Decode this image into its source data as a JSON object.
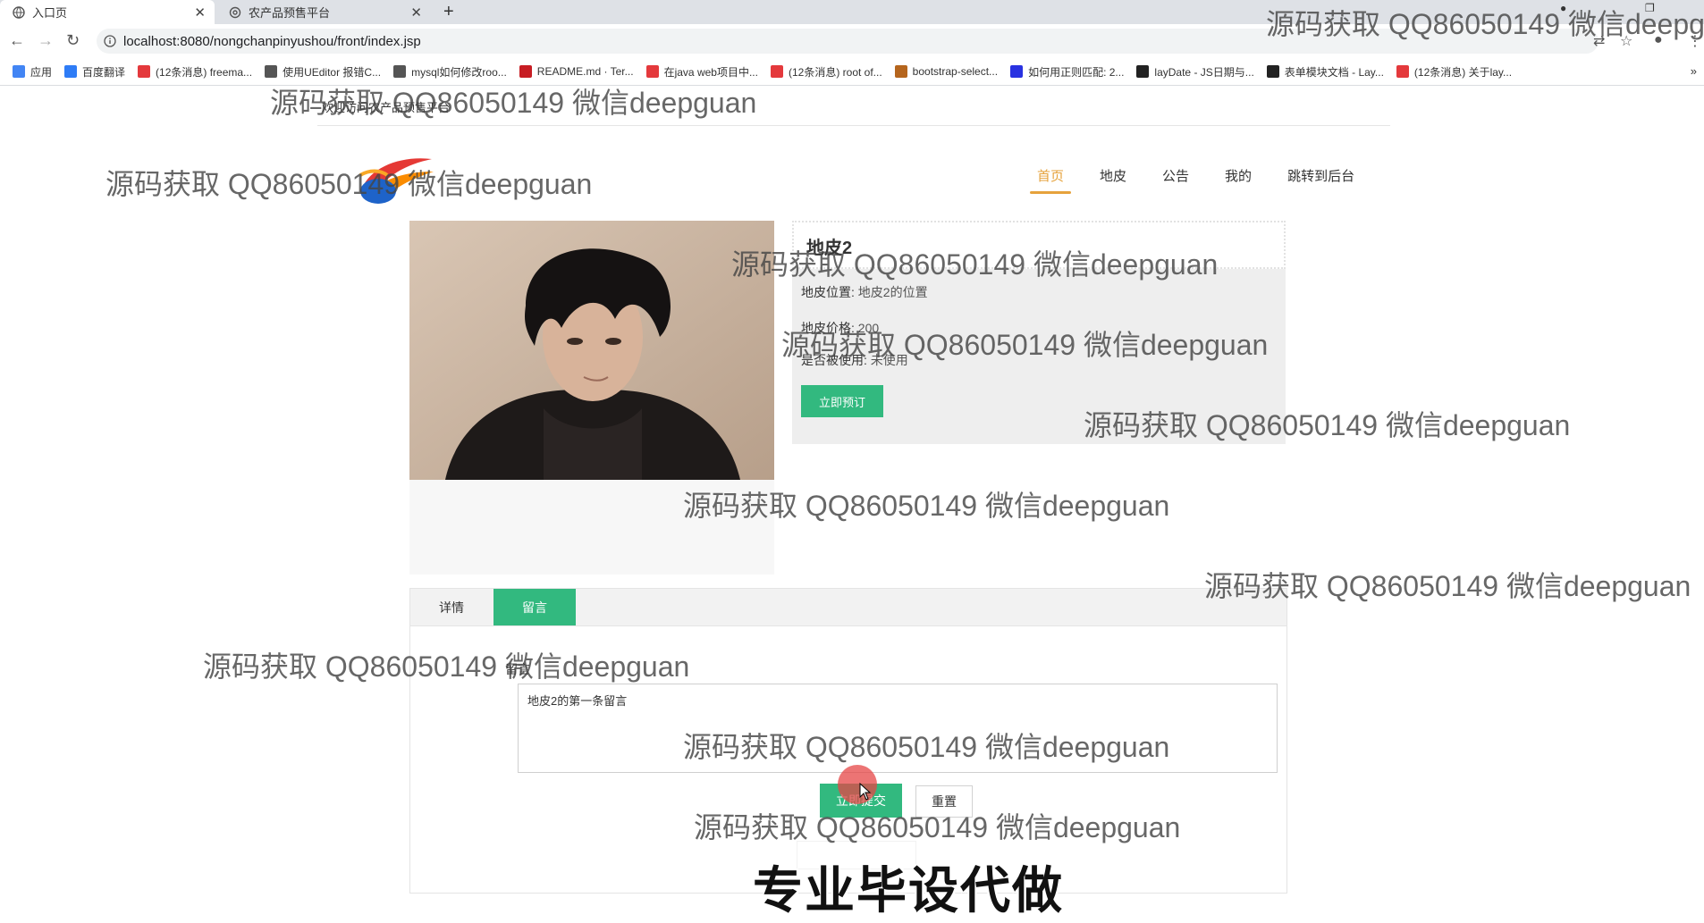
{
  "browser": {
    "tabs": [
      {
        "title": "入口页",
        "icon": "globe-icon"
      },
      {
        "title": "农产品预售平台",
        "icon": "settings-icon"
      }
    ],
    "new_tab": "+",
    "url": "localhost:8080/nongchanpinyushou/front/index.jsp",
    "bookmarks": [
      {
        "label": "应用",
        "color": "#4285f4"
      },
      {
        "label": "百度翻译",
        "color": "#2e7cf6"
      },
      {
        "label": "(12条消息) freema...",
        "color": "#e4393c"
      },
      {
        "label": "使用UEditor 报错C...",
        "color": "#555555"
      },
      {
        "label": "mysql如何修改roo...",
        "color": "#555555"
      },
      {
        "label": "README.md · Ter...",
        "color": "#c71d23"
      },
      {
        "label": "在java web项目中...",
        "color": "#e4393c"
      },
      {
        "label": "(12条消息) root of...",
        "color": "#e4393c"
      },
      {
        "label": "bootstrap-select...",
        "color": "#b5651d"
      },
      {
        "label": "如何用正则匹配: 2...",
        "color": "#2932e1"
      },
      {
        "label": "layDate - JS日期与...",
        "color": "#222222"
      },
      {
        "label": "表单模块文档 - Lay...",
        "color": "#222222"
      },
      {
        "label": "(12条消息) 关于lay...",
        "color": "#e4393c"
      }
    ],
    "more": "»"
  },
  "page": {
    "welcome": "欢迎访问农产品预售平台",
    "nav": [
      "首页",
      "地皮",
      "公告",
      "我的",
      "跳转到后台"
    ],
    "accent": "#32b97f",
    "nav_active_color": "#e6a23c"
  },
  "product": {
    "title": "地皮2",
    "location_label": "地皮位置:",
    "location": "地皮2的位置",
    "price_label": "地皮价格:",
    "price": "200",
    "used_label": "是否被使用:",
    "used": "未使用",
    "reserve_button": "立即预订"
  },
  "tabs": {
    "detail": "详情",
    "comment": "留言"
  },
  "comment_form": {
    "label": "留言",
    "value": "地皮2的第一条留言",
    "submit": "立即提交",
    "reset": "重置"
  },
  "overlay": {
    "watermark": "源码获取 QQ86050149 微信deepguan",
    "banner": "专业毕设代做"
  }
}
